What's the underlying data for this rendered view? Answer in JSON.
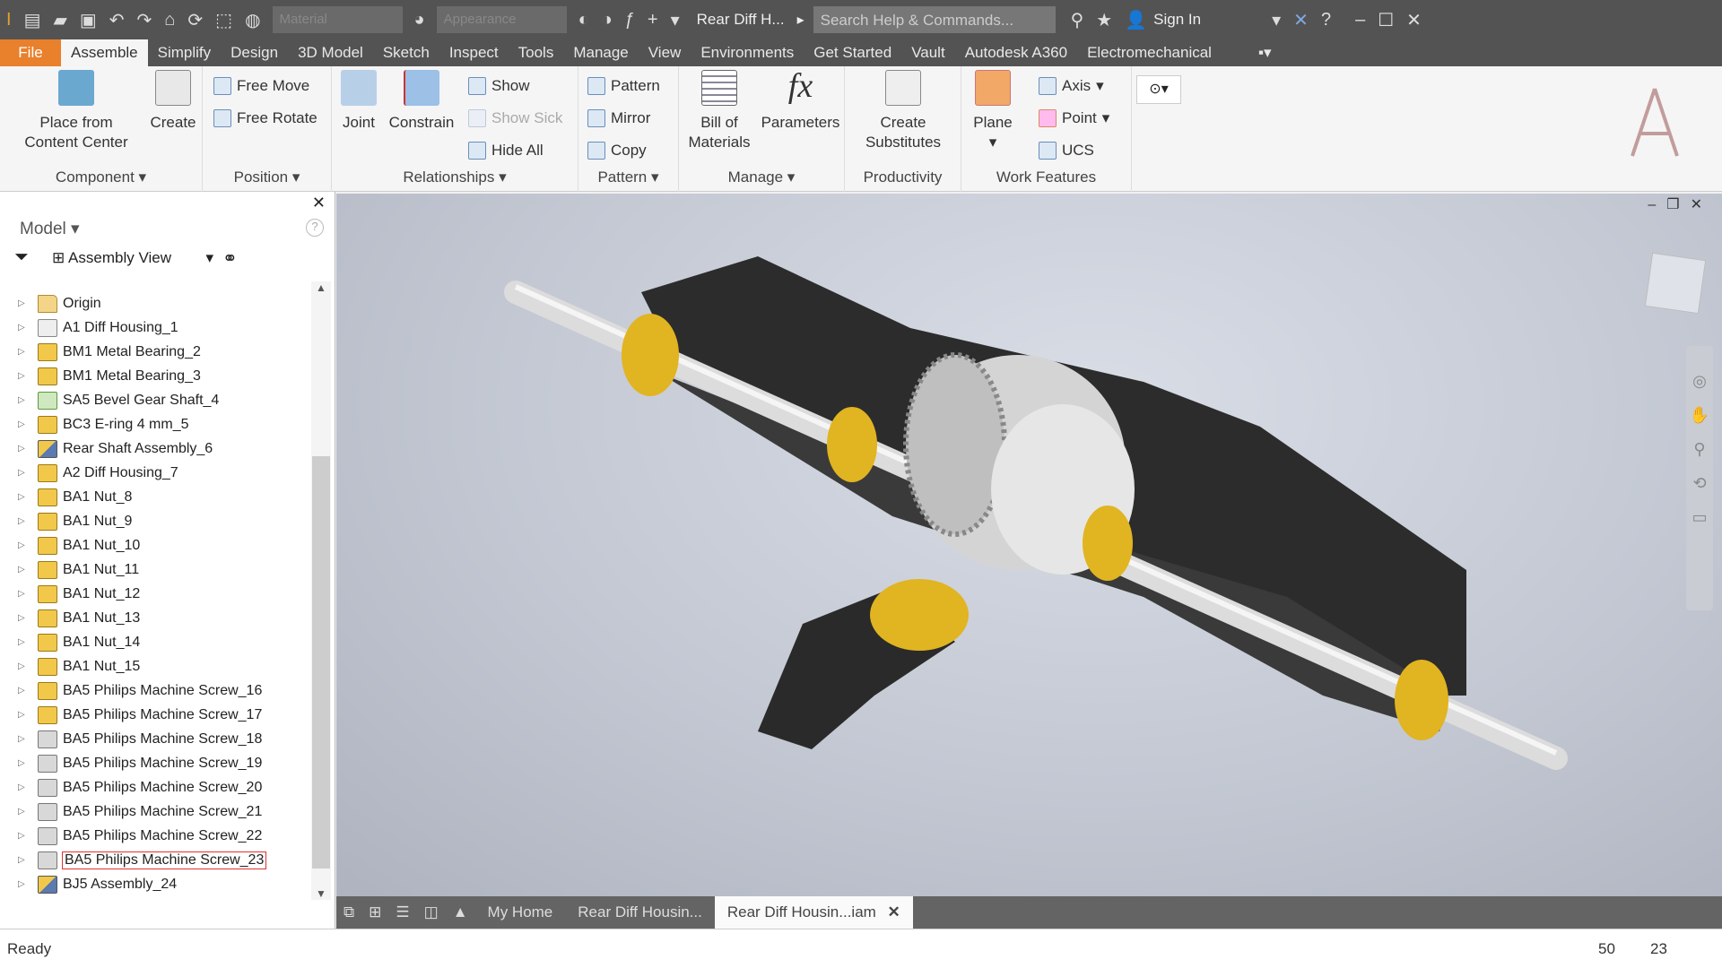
{
  "titlebar": {
    "material": "Material",
    "appearance": "Appearance",
    "doc_title": "Rear Diff H...",
    "search_placeholder": "Search Help & Commands...",
    "sign_in": "Sign In"
  },
  "menu_tabs": [
    "File",
    "Assemble",
    "Simplify",
    "Design",
    "3D Model",
    "Sketch",
    "Inspect",
    "Tools",
    "Manage",
    "View",
    "Environments",
    "Get Started",
    "Vault",
    "Autodesk A360",
    "Electromechanical"
  ],
  "ribbon": {
    "component": {
      "label": "Component",
      "place": "Place from Content Center",
      "create": "Create"
    },
    "position": {
      "label": "Position",
      "free_move": "Free Move",
      "free_rotate": "Free Rotate"
    },
    "relationships": {
      "label": "Relationships",
      "joint": "Joint",
      "constrain": "Constrain",
      "show": "Show",
      "show_sick": "Show Sick",
      "hide_all": "Hide All"
    },
    "pattern": {
      "label": "Pattern",
      "pattern": "Pattern",
      "mirror": "Mirror",
      "copy": "Copy"
    },
    "manage": {
      "label": "Manage",
      "bom": "Bill of Materials",
      "parameters": "Parameters"
    },
    "productivity": {
      "label": "Productivity",
      "substitutes": "Create Substitutes"
    },
    "work_features": {
      "label": "Work Features",
      "plane": "Plane",
      "axis": "Axis",
      "point": "Point",
      "ucs": "UCS"
    }
  },
  "browser": {
    "title": "Model",
    "view": "Assembly View",
    "items": [
      {
        "label": "Origin",
        "icon": "folder"
      },
      {
        "label": "A1 Diff Housing_1",
        "icon": "housing"
      },
      {
        "label": "BM1 Metal Bearing_2",
        "icon": "part"
      },
      {
        "label": "BM1 Metal Bearing_3",
        "icon": "part"
      },
      {
        "label": "SA5 Bevel Gear Shaft_4",
        "icon": "green"
      },
      {
        "label": "BC3 E-ring 4 mm_5",
        "icon": "part"
      },
      {
        "label": "Rear Shaft Assembly_6",
        "icon": "asm"
      },
      {
        "label": "A2 Diff Housing_7",
        "icon": "part"
      },
      {
        "label": "BA1 Nut_8",
        "icon": "part"
      },
      {
        "label": "BA1 Nut_9",
        "icon": "part"
      },
      {
        "label": "BA1 Nut_10",
        "icon": "part"
      },
      {
        "label": "BA1 Nut_11",
        "icon": "part"
      },
      {
        "label": "BA1 Nut_12",
        "icon": "part"
      },
      {
        "label": "BA1 Nut_13",
        "icon": "part"
      },
      {
        "label": "BA1 Nut_14",
        "icon": "part"
      },
      {
        "label": "BA1 Nut_15",
        "icon": "part"
      },
      {
        "label": "BA5 Philips Machine Screw_16",
        "icon": "part"
      },
      {
        "label": "BA5 Philips Machine Screw_17",
        "icon": "part"
      },
      {
        "label": "BA5 Philips Machine Screw_18",
        "icon": "gray"
      },
      {
        "label": "BA5 Philips Machine Screw_19",
        "icon": "gray"
      },
      {
        "label": "BA5 Philips Machine Screw_20",
        "icon": "gray"
      },
      {
        "label": "BA5 Philips Machine Screw_21",
        "icon": "gray"
      },
      {
        "label": "BA5 Philips Machine Screw_22",
        "icon": "gray"
      },
      {
        "label": "BA5 Philips Machine Screw_23",
        "icon": "gray",
        "selected": true
      },
      {
        "label": "BJ5 Assembly_24",
        "icon": "asm"
      }
    ]
  },
  "doc_tabs": [
    "My Home",
    "Rear Diff Housin...",
    "Rear Diff Housin...iam"
  ],
  "status": {
    "text": "Ready",
    "num1": "50",
    "num2": "23"
  },
  "colors": {
    "file_tab": "#e8802c",
    "part_yellow": "#e8b820",
    "housing": "#2b2b2b"
  }
}
